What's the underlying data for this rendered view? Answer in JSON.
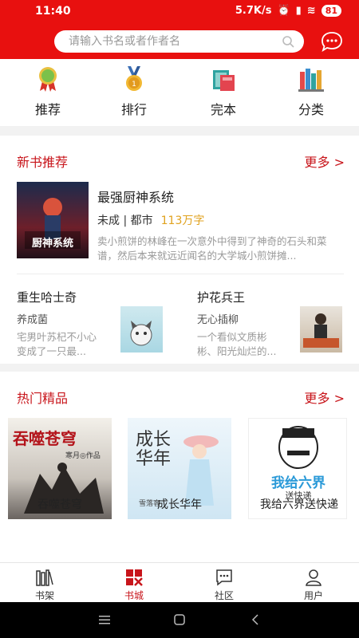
{
  "status": {
    "time": "11:40",
    "speed": "5.7K/s",
    "battery": "81"
  },
  "search": {
    "placeholder": "请输入书名或者作者名"
  },
  "nav": [
    {
      "label": "推荐",
      "icon": "medal-ribbon-icon"
    },
    {
      "label": "排行",
      "icon": "gold-medal-icon"
    },
    {
      "label": "完本",
      "icon": "books-stack-icon"
    },
    {
      "label": "分类",
      "icon": "bookshelf-icon"
    }
  ],
  "new_books": {
    "title": "新书推荐",
    "more": "更多 >",
    "featured": {
      "title": "最强厨神系统",
      "status": "未成",
      "category": "都市",
      "words": "113万字",
      "desc": "卖小煎饼的林峰在一次意外中得到了神奇的石头和菜谱，然后本来就远近闻名的大学城小煎饼摊...",
      "cover_text": "厨神系统"
    },
    "items": [
      {
        "title": "重生哈士奇",
        "author": "养成菌",
        "desc": "宅男叶苏杞不小心变成了一只最..."
      },
      {
        "title": "护花兵王",
        "author": "无心插柳",
        "desc": "一个看似文质彬彬、阳光灿烂的..."
      }
    ]
  },
  "hot": {
    "title": "热门精品",
    "more": "更多 >",
    "items": [
      {
        "title": "吞噬苍穹",
        "cover_text": "吞噬苍穹",
        "cover_sub": "寒月◎作品"
      },
      {
        "title": "成长华年",
        "cover_text": "成长华年",
        "cover_sub": "雪落客"
      },
      {
        "title": "我给六界送快递",
        "cover_text": "我给六界",
        "cover_sub": "送快递"
      }
    ]
  },
  "tabs": [
    {
      "label": "书架",
      "icon": "bookshelf-tab-icon",
      "active": false
    },
    {
      "label": "书城",
      "icon": "bookstore-tab-icon",
      "active": true
    },
    {
      "label": "社区",
      "icon": "chat-tab-icon",
      "active": false
    },
    {
      "label": "用户",
      "icon": "user-tab-icon",
      "active": false
    }
  ]
}
